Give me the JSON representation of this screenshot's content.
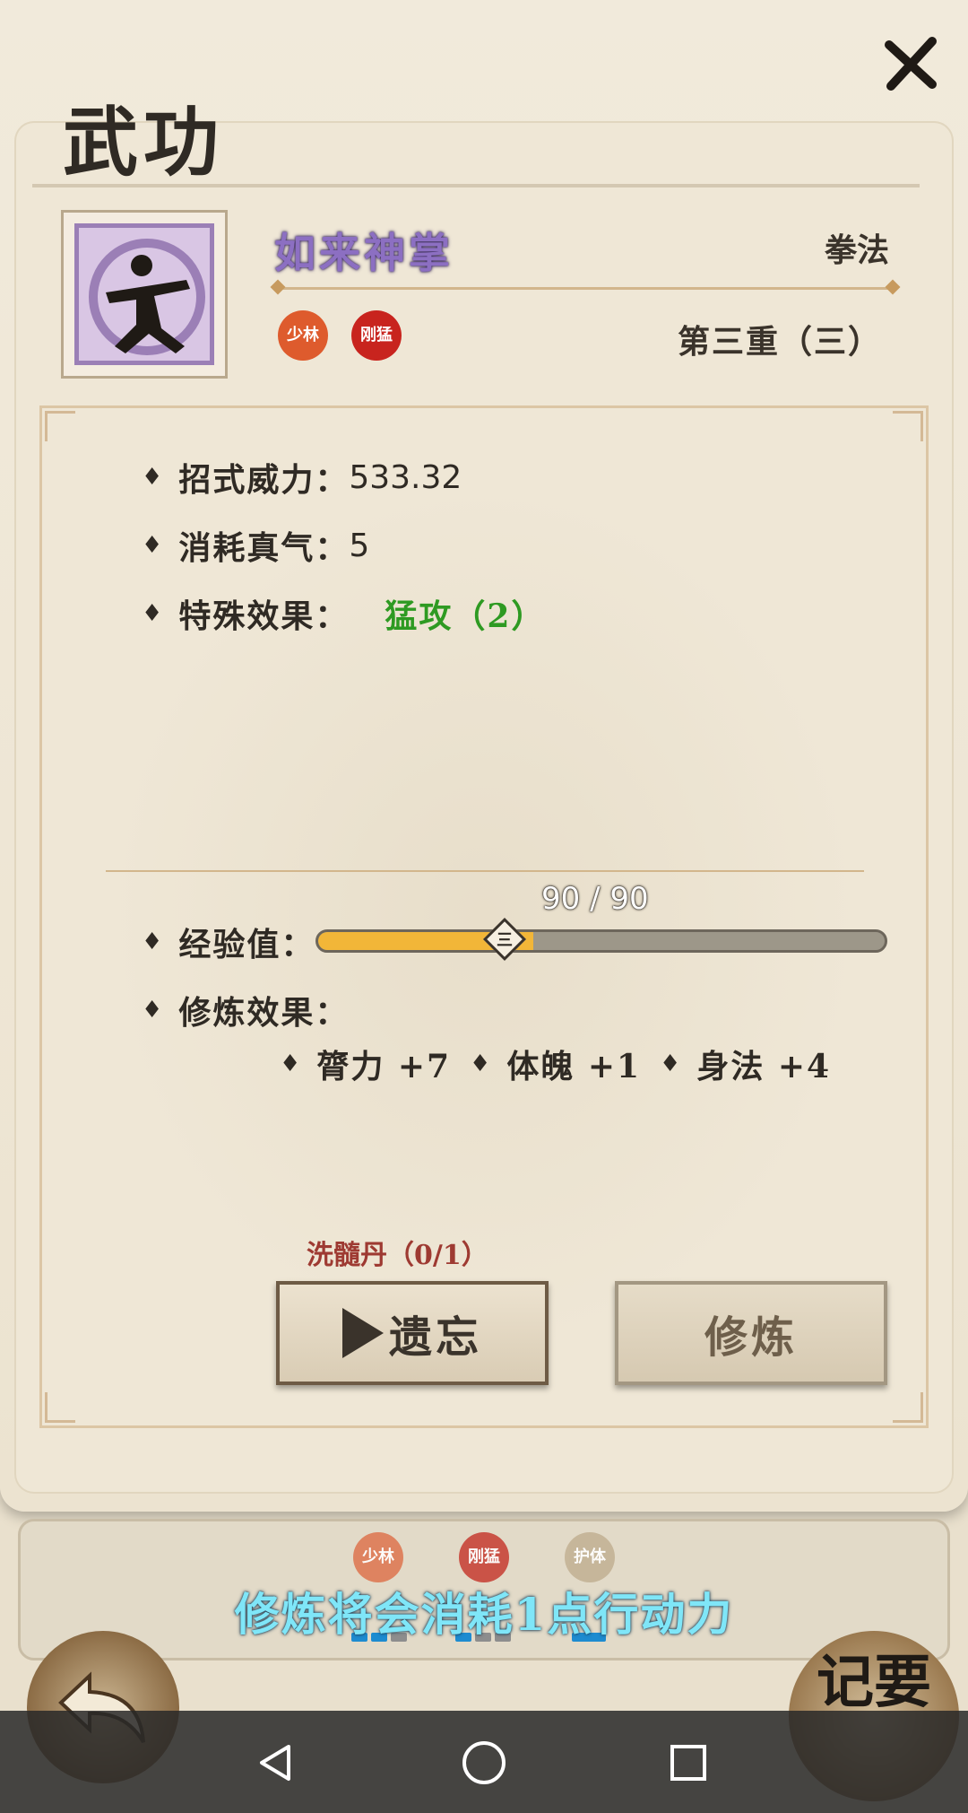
{
  "window": {
    "title": "武功"
  },
  "skill": {
    "name": "如来神掌",
    "type": "拳法",
    "level": "第三重（三）",
    "seals": [
      "少林",
      "刚猛"
    ],
    "icon_color": "#9b7fb6"
  },
  "stats": {
    "power_label": "招式威力：",
    "power_value": "533.32",
    "cost_label": "消耗真气：",
    "cost_value": "5",
    "effect_label": "特殊效果：",
    "effect_value": "猛攻（2）"
  },
  "experience": {
    "label": "经验值：",
    "display": "90 / 90",
    "marker": "三",
    "progress": 0.38
  },
  "training": {
    "label": "修炼效果：",
    "bonuses": [
      "膂力 +7",
      "体魄 +1",
      "身法 +4"
    ]
  },
  "actions": {
    "pill_label": "洗髓丹（0/1）",
    "forget_label": "遗忘",
    "train_label": "修炼"
  },
  "bottom": {
    "seals": [
      "少林",
      "刚猛",
      "护体"
    ],
    "toast": "修炼将会消耗1点行动力",
    "notes_label": "记要"
  },
  "colors": {
    "accent_green": "#2e9a22",
    "exp_bar": "#f2b638",
    "toast": "#7fe6f8"
  }
}
